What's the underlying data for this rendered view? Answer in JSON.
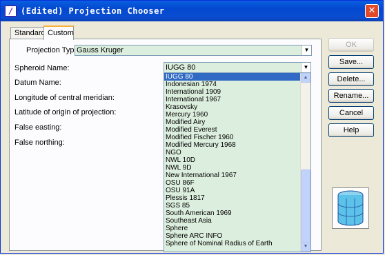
{
  "window": {
    "title": "(Edited) Projection Chooser",
    "close_glyph": "✕",
    "icon_letter": "/"
  },
  "tabs": [
    {
      "label": "Standard",
      "active": false
    },
    {
      "label": "Custom",
      "active": true
    }
  ],
  "form": {
    "projection_type_label": "Projection Type :",
    "projection_type_value": "Gauss Kruger",
    "spheroid_label": "Spheroid Name:",
    "spheroid_value": "IUGG 80",
    "datum_label": "Datum Name:",
    "central_meridian_label": "Longitude of central meridian:",
    "origin_latitude_label": "Latitude of origin of projection:",
    "false_easting_label": "False easting:",
    "false_northing_label": "False northing:"
  },
  "spheroid_list": {
    "selected": "IUGG 80",
    "items": [
      "IUGG 80",
      "Indonesian 1974",
      "International 1909",
      "International 1967",
      "Krasovsky",
      "Mercury 1960",
      "Modified Airy",
      "Modified Everest",
      "Modified Fischer 1960",
      "Modified Mercury 1968",
      "NGO",
      "NWL 10D",
      "NWL 9D",
      "New International 1967",
      "OSU 86F",
      "OSU 91A",
      "Plessis 1817",
      "SGS 85",
      "South American 1969",
      "Southeast Asia",
      "Sphere",
      "Sphere ARC INFO",
      "Sphere of Nominal Radius of Earth"
    ]
  },
  "buttons": {
    "ok": "OK",
    "save": "Save...",
    "delete": "Delete...",
    "rename": "Rename...",
    "cancel": "Cancel",
    "help": "Help"
  },
  "icons": {
    "close": "close-icon",
    "dropdown": "chevron-down-icon",
    "globe": "globe-icon"
  },
  "colors": {
    "titlebar": "#0a5fe0",
    "field_bg": "#dceedd",
    "selection": "#316ac5"
  }
}
